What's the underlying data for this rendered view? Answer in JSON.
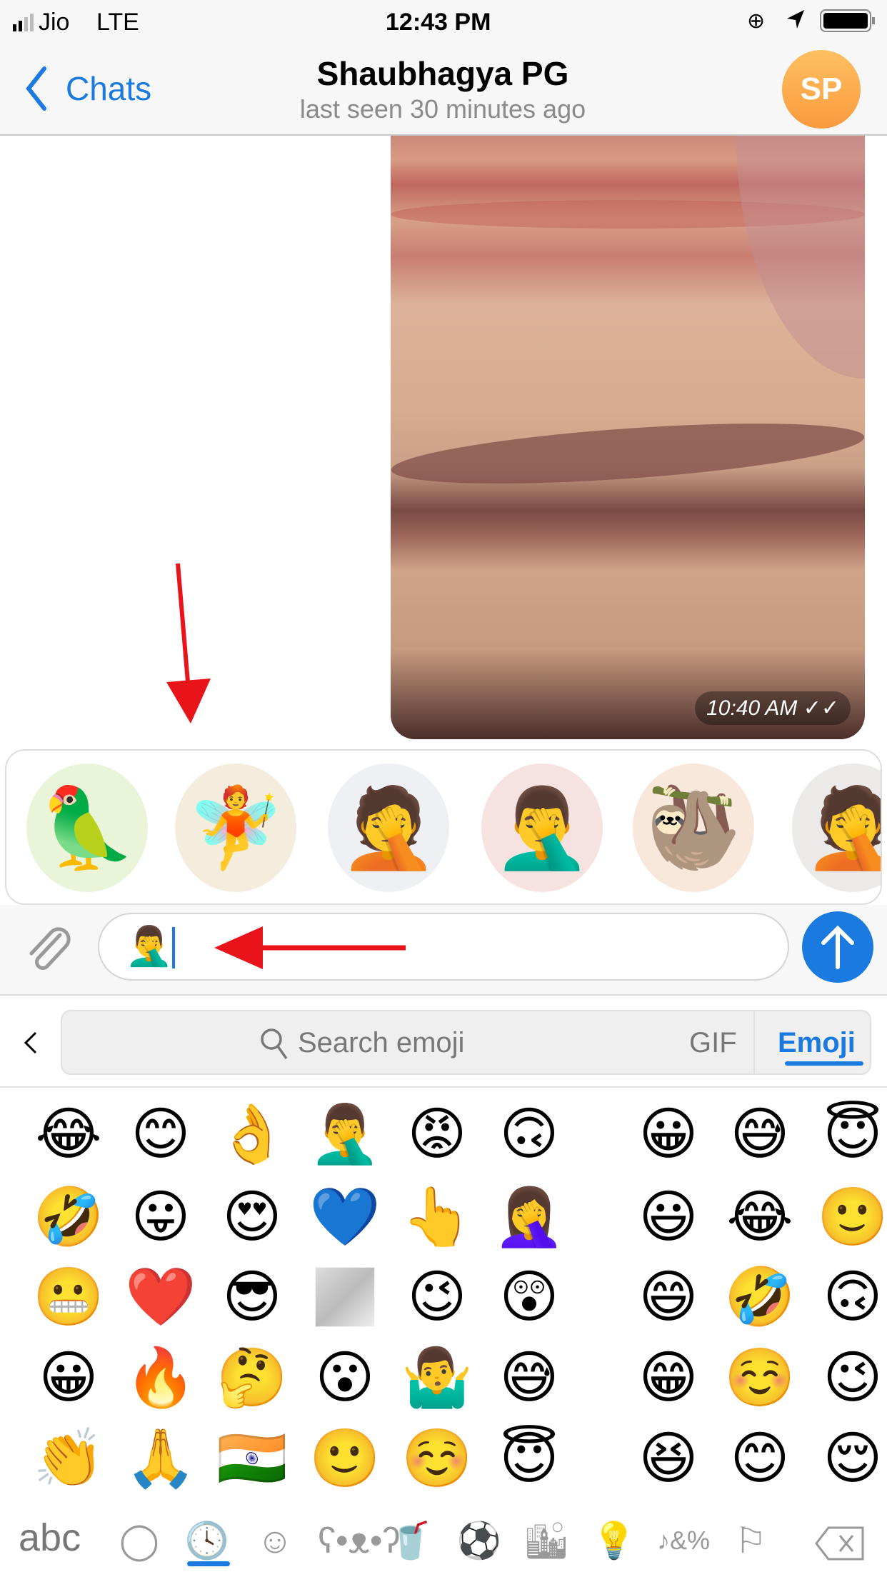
{
  "status_bar": {
    "carrier": "Jio",
    "network": "LTE",
    "time": "12:43 PM"
  },
  "header": {
    "back_label": "Chats",
    "title": "Shaubhagya PG",
    "subtitle": "last seen 30 minutes ago",
    "avatar_initials": "SP",
    "accent": "#1b7ae0",
    "avatar_color": "#fbaa45"
  },
  "message": {
    "time": "10:40 AM",
    "read_icon": "double-check-icon"
  },
  "stickers": [
    "🦜",
    "🧚",
    "🤦",
    "🤦‍♂️",
    "🦥",
    "🤦"
  ],
  "input": {
    "value": "🤦‍♂️"
  },
  "emoji_search": {
    "placeholder": "Search emoji",
    "gif_label": "GIF",
    "emoji_label": "Emoji"
  },
  "emoji_grid": [
    [
      "😂",
      "😊",
      "👌",
      "🤦‍♂️",
      "😡",
      "🙃",
      "😀",
      "😅",
      "😇"
    ],
    [
      "🤣",
      "😛",
      "😍",
      "💙",
      "👆",
      "🤦‍♀️",
      "😃",
      "😂",
      "🙂"
    ],
    [
      "😬",
      "❤️",
      "😎",
      "",
      "😉",
      "😲",
      "😄",
      "🤣",
      "🙃"
    ],
    [
      "😀",
      "🔥",
      "🤔",
      "😮",
      "🤷‍♂️",
      "😅",
      "😁",
      "☺️",
      "😉"
    ],
    [
      "👏",
      "🙏",
      "🇮🇳",
      "🙂",
      "☺️",
      "😇",
      "😆",
      "😊",
      "😌"
    ]
  ],
  "keyboard_tabs": {
    "abc_label": "abc",
    "active": "recent"
  }
}
